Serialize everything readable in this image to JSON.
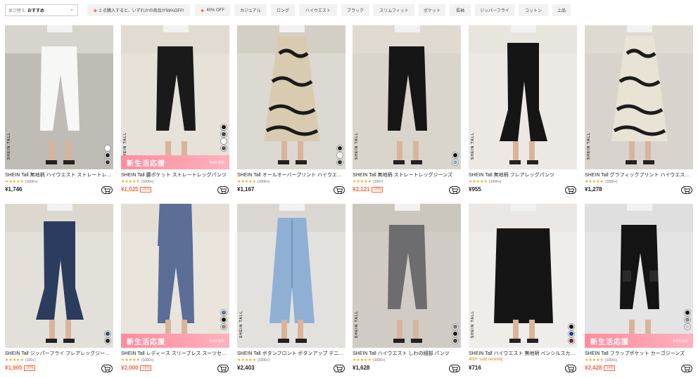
{
  "sort": {
    "label": "並び替え",
    "value": "おすすめ"
  },
  "chips": [
    {
      "label": "2 点購入すると、いずれかの商品が99%OFF!",
      "icon": "tag-icon"
    },
    {
      "label": "40% OFF",
      "icon": "tag-icon"
    },
    {
      "label": "カジュアル"
    },
    {
      "label": "ロング"
    },
    {
      "label": "ハイウエスト"
    },
    {
      "label": "ブラック"
    },
    {
      "label": "スリムフィット"
    },
    {
      "label": "ポケット"
    },
    {
      "label": "長袖"
    },
    {
      "label": "ジッパーフライ"
    },
    {
      "label": "コットン"
    },
    {
      "label": "上品"
    }
  ],
  "products": [
    {
      "brand": "SHEIN TALL",
      "title": "SHEIN Tall 無地柄 ハイウエスト ストレートレッグパンツ",
      "stars": "★★★★★",
      "reviews": "(1000+)",
      "price": "¥1,746",
      "sale": false,
      "swatches": [
        "#ffffff",
        "#222222",
        "#333333"
      ]
    },
    {
      "brand": "SHEIN TALL",
      "title": "SHEIN Tall 腰ポケット ストレートレッグパンツ",
      "stars": "★★★★★",
      "reviews": "(1000+)",
      "price": "¥1,025",
      "sale": true,
      "discount": "-26%",
      "promo": "新生活応援",
      "promo_off": "¥581 割引",
      "swatches": [
        "#111111",
        "#444444",
        "#ffffff",
        "#555555"
      ]
    },
    {
      "brand": "",
      "title": "SHEIN Tall オールオーバープリント ハイウエストスカート",
      "stars": "★★★★★",
      "reviews": "(1000+)",
      "price": "¥1,167",
      "sale": false,
      "swatches": [
        "#222222",
        "#f5f0e6",
        "#333333"
      ]
    },
    {
      "brand": "SHEIN TALL",
      "title": "SHEIN Tall 無地柄 ストレートレッグジーンズ",
      "stars": "★★★★★",
      "reviews": "(100+)",
      "price": "¥2,121",
      "sale": true,
      "discount": "-20%",
      "swatches": [
        "#111111",
        "#8fa8c6"
      ]
    },
    {
      "brand": "SHEIN TALL",
      "title": "SHEIN Tall 無地柄 フレアレッグパンツ",
      "stars": "★★★★★",
      "reviews": "(1000+)",
      "price": "¥955",
      "sale": false,
      "swatches": []
    },
    {
      "brand": "SHEIN TALL",
      "title": "SHEIN Tall グラフィックプリント ハイウエストスカート",
      "stars": "★★★★★",
      "reviews": "(1000+)",
      "price": "¥1,278",
      "sale": false,
      "swatches": []
    },
    {
      "brand": "",
      "title": "SHEIN Tall ジッパーフライ フレアレッグジーンズ",
      "stars": "★★★★★",
      "reviews": "(100+)",
      "price": "¥1,905",
      "sale": true,
      "discount": "-20%",
      "swatches": [
        "#3a4a6b",
        "#1a1a1a"
      ]
    },
    {
      "brand": "",
      "title": "SHEIN Tall レディース スリーブレス スーツセット",
      "stars": "★★★★★",
      "reviews": "(1000+)",
      "price": "¥2,000",
      "sale": true,
      "discount": "-15%",
      "promo": "新生活応援",
      "promo_off": "¥363 割引",
      "swatches": [
        "#5a6f9a",
        "#111111",
        "#888888"
      ]
    },
    {
      "brand": "SHEIN TALL",
      "title": "SHEIN Tall ボタンフロント ボタンアップ デニムスカート",
      "stars": "★★★★★",
      "reviews": "(1000+)",
      "price": "¥2,403",
      "sale": false,
      "swatches": []
    },
    {
      "brand": "SHEIN TALL",
      "title": "SHEIN Tall ハイウエスト しわの細部 パンツ",
      "stars": "★★★★★",
      "reviews": "(1000+)",
      "price": "¥1,628",
      "sale": false,
      "swatches": [
        "#777777",
        "#111111",
        "#444444"
      ]
    },
    {
      "brand": "SHEIN TALL",
      "title": "SHEIN Tall ハイウエスト 無地柄 ペンシルスカート",
      "sold": "400+ sold recently",
      "price": "¥716",
      "sale": false,
      "swatches": [
        "#111111",
        "#1e3a8a",
        "#7a1f3d"
      ]
    },
    {
      "brand": "",
      "title": "SHEIN Tall フラップポケット カーゴジーンズ",
      "stars": "★★★★★",
      "reviews": "(1000+)",
      "price": "¥2,428",
      "sale": true,
      "discount": "-14%",
      "promo": "新生活応援",
      "promo_off": "¥420 割引",
      "swatches": [
        "#111111",
        "#888888",
        "#cccccc"
      ]
    }
  ]
}
